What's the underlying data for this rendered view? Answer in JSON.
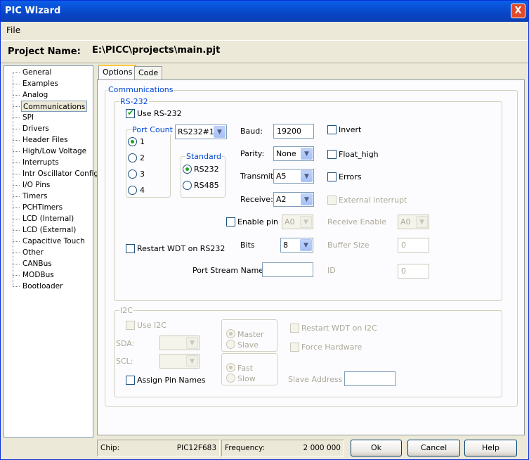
{
  "window": {
    "title": "PIC Wizard",
    "close_glyph": "X"
  },
  "menu": {
    "file": "File"
  },
  "project": {
    "label": "Project Name:",
    "value": "E:\\PICC\\projects\\main.pjt"
  },
  "tree": [
    "General",
    "Examples",
    "Analog",
    "Communications",
    "SPI",
    "Drivers",
    "Header Files",
    "High/Low Voltage",
    "Interrupts",
    "Intr Oscillator Config",
    "I/O Pins",
    "Timers",
    "PCHTimers",
    "LCD (Internal)",
    "LCD (External)",
    "Capacitive Touch",
    "Other",
    "CANBus",
    "MODBus",
    "Bootloader"
  ],
  "tabs": {
    "options": "Options",
    "code": "Code"
  },
  "communications": {
    "title": "Communications",
    "rs232": {
      "title": "RS-232",
      "use": "Use RS-232",
      "port_count": {
        "title": "Port Count",
        "options": [
          "1",
          "2",
          "3",
          "4"
        ],
        "selected": "1"
      },
      "port_select": "RS232#1",
      "standard": {
        "title": "Standard",
        "options": [
          "RS232",
          "RS485"
        ],
        "selected": "RS232"
      },
      "baud_label": "Baud:",
      "baud_value": "19200",
      "parity_label": "Parity:",
      "parity_value": "None",
      "transmit_label": "Transmit:",
      "transmit_value": "A5",
      "receive_label": "Receive:",
      "receive_value": "A2",
      "invert": "Invert",
      "float_high": "Float_high",
      "errors": "Errors",
      "external_interrupt": "External interrupt",
      "enable_pin": "Enable pin",
      "enable_pin_value": "A0",
      "receive_enable": "Receive Enable",
      "receive_enable_value": "A0",
      "restart_wdt": "Restart WDT on RS232",
      "bits_label": "Bits",
      "bits_value": "8",
      "buffer_size": "Buffer Size",
      "buffer_size_value": "0",
      "port_stream": "Port Stream Name",
      "port_stream_value": "",
      "id_label": "ID",
      "id_value": "0"
    },
    "i2c": {
      "title": "I2C",
      "use": "Use I2C",
      "sda": "SDA:",
      "scl": "SCL:",
      "assign": "Assign Pin Names",
      "master": "Master",
      "slave": "Slave",
      "fast": "Fast",
      "slow": "Slow",
      "restart_wdt": "Restart WDT on I2C",
      "force_hw": "Force Hardware",
      "slave_address": "Slave Address",
      "slave_address_value": ""
    }
  },
  "status": {
    "chip_label": "Chip:",
    "chip_value": "PIC12F683",
    "freq_label": "Frequency:",
    "freq_value": "2 000 000"
  },
  "buttons": {
    "ok": "Ok",
    "cancel": "Cancel",
    "help": "Help"
  }
}
